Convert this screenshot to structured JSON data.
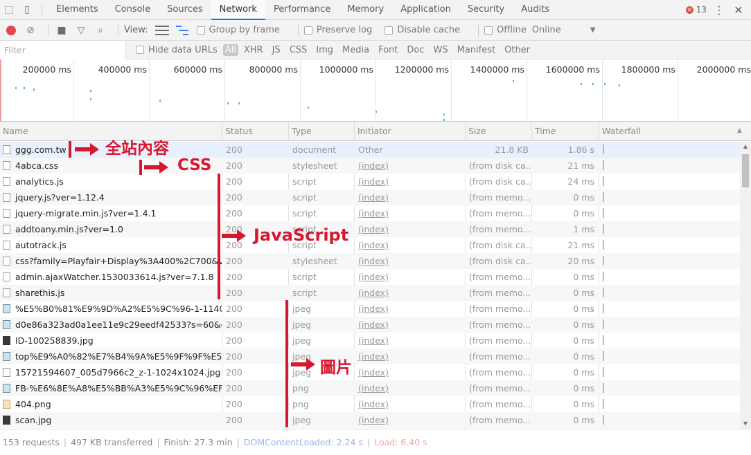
{
  "tabs": [
    "Elements",
    "Console",
    "Sources",
    "Network",
    "Performance",
    "Memory",
    "Application",
    "Security",
    "Audits"
  ],
  "active_tab": "Network",
  "error_count": "13",
  "toolbar": {
    "view_label": "View:",
    "group_by_frame": "Group by frame",
    "preserve_log": "Preserve log",
    "disable_cache": "Disable cache",
    "offline": "Offline",
    "throttle": "Online"
  },
  "filter": {
    "placeholder": "Filter",
    "hide_data_urls": "Hide data URLs",
    "types": [
      "All",
      "XHR",
      "JS",
      "CSS",
      "Img",
      "Media",
      "Font",
      "Doc",
      "WS",
      "Manifest",
      "Other"
    ]
  },
  "overview_ticks": [
    "200000 ms",
    "400000 ms",
    "600000 ms",
    "800000 ms",
    "1000000 ms",
    "1200000 ms",
    "1400000 ms",
    "1600000 ms",
    "1800000 ms",
    "2000000 ms"
  ],
  "columns": {
    "name": "Name",
    "status": "Status",
    "type": "Type",
    "initiator": "Initiator",
    "size": "Size",
    "time": "Time",
    "waterfall": "Waterfall"
  },
  "rows": [
    {
      "name": "ggg.com.tw",
      "status": "200",
      "type": "document",
      "initiator": "Other",
      "size": "21.8 KB",
      "time": "1.86 s",
      "icon": "doc"
    },
    {
      "name": "4abca.css",
      "status": "200",
      "type": "stylesheet",
      "initiator": "(index)",
      "size": "(from disk ca...",
      "time": "21 ms",
      "icon": "doc"
    },
    {
      "name": "analytics.js",
      "status": "200",
      "type": "script",
      "initiator": "(index)",
      "size": "(from disk ca...",
      "time": "24 ms",
      "icon": "doc"
    },
    {
      "name": "jquery.js?ver=1.12.4",
      "status": "200",
      "type": "script",
      "initiator": "(index)",
      "size": "(from memo...",
      "time": "0 ms",
      "icon": "doc"
    },
    {
      "name": "jquery-migrate.min.js?ver=1.4.1",
      "status": "200",
      "type": "script",
      "initiator": "(index)",
      "size": "(from memo...",
      "time": "0 ms",
      "icon": "doc"
    },
    {
      "name": "addtoany.min.js?ver=1.0",
      "status": "200",
      "type": "script",
      "initiator": "(index)",
      "size": "(from memo...",
      "time": "1 ms",
      "icon": "doc"
    },
    {
      "name": "autotrack.js",
      "status": "200",
      "type": "script",
      "initiator": "(index)",
      "size": "(from disk ca...",
      "time": "21 ms",
      "icon": "doc"
    },
    {
      "name": "css?family=Playfair+Display%3A400%2C700&ve...",
      "status": "200",
      "type": "stylesheet",
      "initiator": "(index)",
      "size": "(from disk ca...",
      "time": "20 ms",
      "icon": "doc"
    },
    {
      "name": "admin.ajaxWatcher.1530033614.js?ver=7.1.8",
      "status": "200",
      "type": "script",
      "initiator": "(index)",
      "size": "(from memo...",
      "time": "0 ms",
      "icon": "doc"
    },
    {
      "name": "sharethis.js",
      "status": "200",
      "type": "script",
      "initiator": "(index)",
      "size": "(from memo...",
      "time": "0 ms",
      "icon": "doc"
    },
    {
      "name": "%E5%B0%81%E9%9D%A2%E5%9C%96-1-1140x...",
      "status": "200",
      "type": "jpeg",
      "initiator": "(index)",
      "size": "(from memo...",
      "time": "0 ms",
      "icon": "img"
    },
    {
      "name": "d0e86a323ad0a1ee11e9c29eedf42533?s=60&d...",
      "status": "200",
      "type": "jpeg",
      "initiator": "(index)",
      "size": "(from memo...",
      "time": "0 ms",
      "icon": "img"
    },
    {
      "name": "ID-100258839.jpg",
      "status": "200",
      "type": "jpeg",
      "initiator": "(index)",
      "size": "(from memo...",
      "time": "0 ms",
      "icon": "dark"
    },
    {
      "name": "top%E9%A0%82%E7%B4%9A%E5%9F%9F%E5%...",
      "status": "200",
      "type": "jpeg",
      "initiator": "(index)",
      "size": "(from memo...",
      "time": "0 ms",
      "icon": "img"
    },
    {
      "name": "15721594607_005d7966c2_z-1-1024x1024.jpg",
      "status": "200",
      "type": "jpeg",
      "initiator": "(index)",
      "size": "(from memo...",
      "time": "0 ms",
      "icon": "doc"
    },
    {
      "name": "FB-%E6%8E%A8%E5%BB%A3%E5%9C%96%EF...",
      "status": "200",
      "type": "png",
      "initiator": "(index)",
      "size": "(from memo...",
      "time": "0 ms",
      "icon": "img"
    },
    {
      "name": "404.png",
      "status": "200",
      "type": "png",
      "initiator": "(index)",
      "size": "(from memo...",
      "time": "0 ms",
      "icon": "orange"
    },
    {
      "name": "scan.jpg",
      "status": "200",
      "type": "jpeg",
      "initiator": "(index)",
      "size": "(from memo...",
      "time": "0 ms",
      "icon": "dark"
    }
  ],
  "statusbar": {
    "requests": "153 requests",
    "transferred": "497 KB transferred",
    "finish": "Finish: 27.3 min",
    "dcl": "DOMContentLoaded: 2.24 s",
    "load": "Load: 6.40 s"
  },
  "annotations": {
    "content": "全站內容",
    "css": "CSS",
    "js": "JavaScript",
    "images": "圖片"
  },
  "colors": {
    "annotation_red": "#d6182e",
    "active_tab_underline": "#1a73e8",
    "record_red": "#e0464b"
  }
}
